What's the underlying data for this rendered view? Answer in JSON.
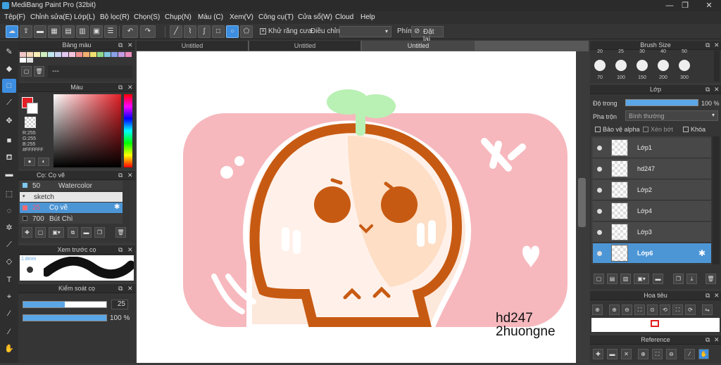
{
  "window": {
    "title": "MediBang Paint Pro (32bit)",
    "controls": [
      "—",
      "❐",
      "✕"
    ]
  },
  "menu": [
    "Tệp(F)",
    "Chỉnh sửa(E)",
    "Lớp(L)",
    "Bộ lọc(R)",
    "Chọn(S)",
    "Chụp(N)",
    "Màu (C)",
    "Xem(V)",
    "Công cụ(T)",
    "Cửa sổ(W)",
    "Cloud",
    "Help"
  ],
  "toolbar": {
    "antialias_label": "Khử răng cưa",
    "adjust_label": "Điều chỉnh",
    "shortcut_label": "Phím",
    "reset_label": "Đặt lại"
  },
  "palette_panel": {
    "title": "Bảng màu",
    "item_placeholder": "---"
  },
  "color_panel": {
    "title": "Màu",
    "r": "R:255",
    "g": "G:255",
    "b": "B:255",
    "hex": "#FFFFFF"
  },
  "brush_panel": {
    "title": "Cọ: Cọ vẽ",
    "items": [
      {
        "size": "50",
        "name": "Watercolor"
      },
      {
        "size": "",
        "name": "sketch"
      },
      {
        "size": "25",
        "name": "Cọ vẽ"
      },
      {
        "size": "700",
        "name": "Bút Chì"
      }
    ]
  },
  "preview_panel": {
    "title": "Xem trước cọ",
    "size": "1.8mm"
  },
  "brush_control": {
    "title": "Kiểm soát cọ",
    "size_value": "25",
    "opacity_value": "100 %",
    "size_fraction": 0.5,
    "opacity_fraction": 1.0
  },
  "tabs": [
    "Untitled",
    "Untitled",
    "Untitled"
  ],
  "canvas": {
    "text_line1": "hd247",
    "text_line2": "2huongne"
  },
  "brushsize_panel": {
    "title": "Brush Size",
    "top_sizes": [
      "20",
      "25",
      "30",
      "40",
      "50"
    ],
    "sizes": [
      "70",
      "100",
      "150",
      "200",
      "300"
    ]
  },
  "layer_panel": {
    "title": "Lớp",
    "opacity_label": "Độ trong",
    "opacity_value": "100 %",
    "opacity_fraction": 1.0,
    "blend_label": "Pha trộn",
    "blend_value": "Bình thường",
    "protect_alpha": "Bảo vệ alpha",
    "clipping": "Xén bớt",
    "lock": "Khóa",
    "layers": [
      "Lớp1",
      "hd247",
      "Lớp2",
      "Lớp4",
      "Lớp3",
      "Lớp6"
    ]
  },
  "navigator_panel": {
    "title": "Hoa tiêu"
  },
  "reference_panel": {
    "title": "Reference"
  },
  "colors": {
    "accent": "#3d8ee0",
    "pink": "#f6b8bd",
    "orange": "#c75a12",
    "peach": "#fde0c8",
    "leaf": "#b9f0b4"
  }
}
